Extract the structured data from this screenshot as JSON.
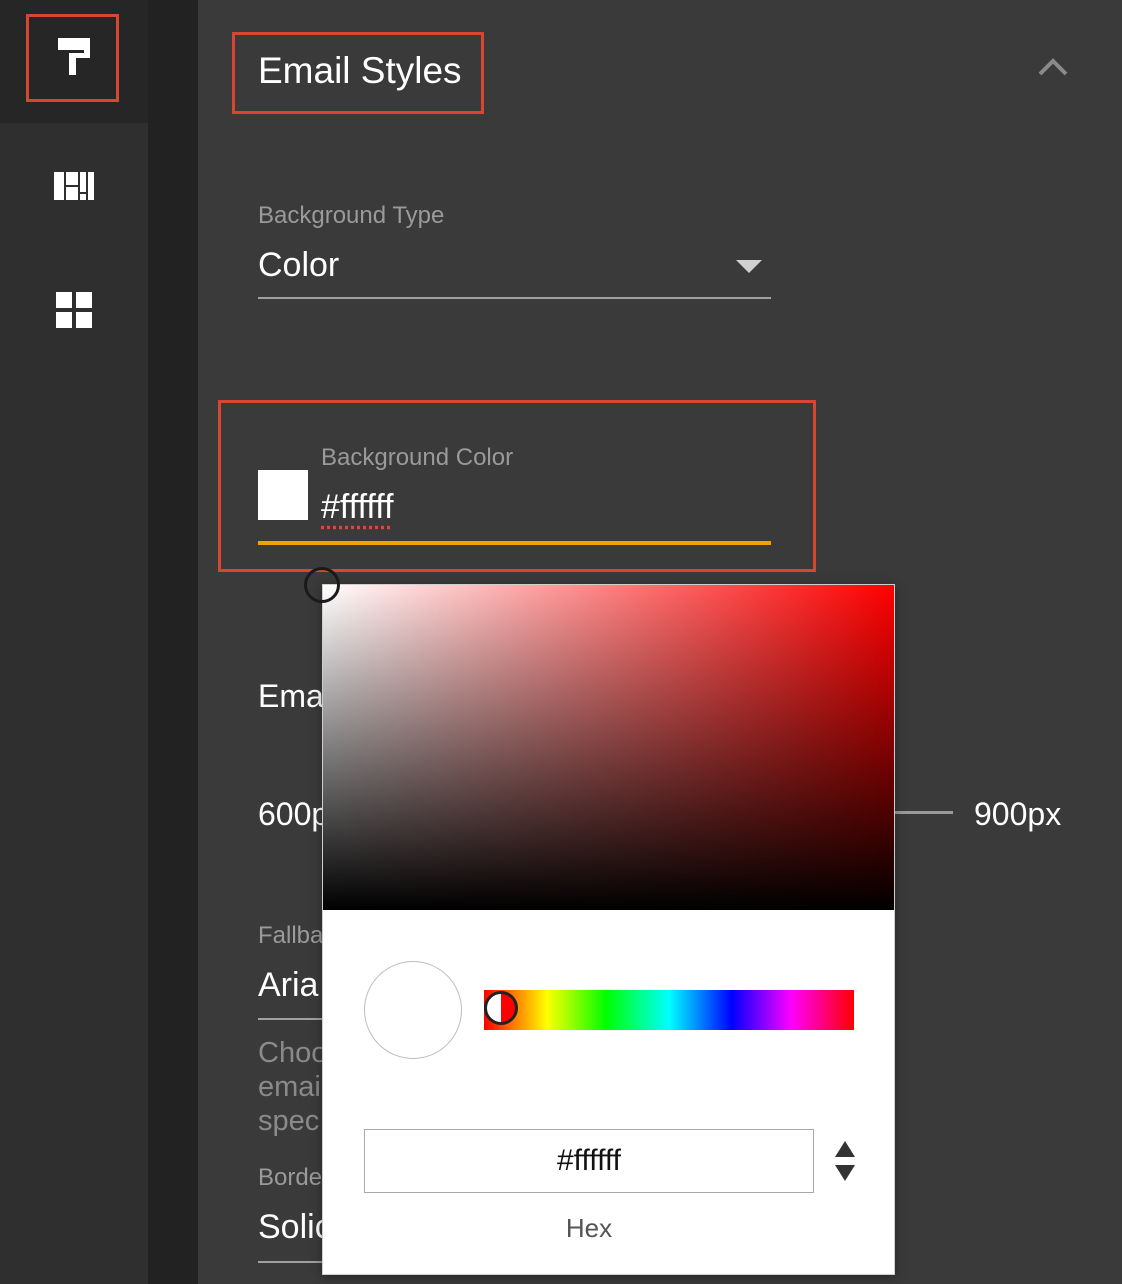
{
  "sidebar": {
    "items": [
      {
        "icon": "paint-roller-icon",
        "active": true
      },
      {
        "icon": "layout-blocks-icon",
        "active": false
      },
      {
        "icon": "grid-icon",
        "active": false
      }
    ]
  },
  "panel": {
    "title": "Email Styles",
    "collapse_icon": "chevron-up-icon",
    "background_type": {
      "label": "Background Type",
      "value": "Color"
    },
    "background_color": {
      "label": "Background Color",
      "value": "#ffffff",
      "underline_color": "#f5a000"
    },
    "email_width": {
      "label_partial": "Ema",
      "min_partial": "600p",
      "max": "900px"
    },
    "fallback_font": {
      "label_partial": "Fallba",
      "value_partial": "Aria"
    },
    "help_text_partial": [
      "Choo",
      "emai",
      "spec"
    ],
    "border": {
      "label_partial": "Borde",
      "value_partial": "Solic"
    }
  },
  "color_picker": {
    "hex_value": "#ffffff",
    "format_label": "Hex",
    "selected_color": "#ffffff",
    "hue": "#ff0000"
  },
  "colors": {
    "highlight": "#d94531",
    "panel_bg": "#3a3a3a",
    "rail_bg": "#2f2f2f",
    "accent": "#f5a000"
  }
}
